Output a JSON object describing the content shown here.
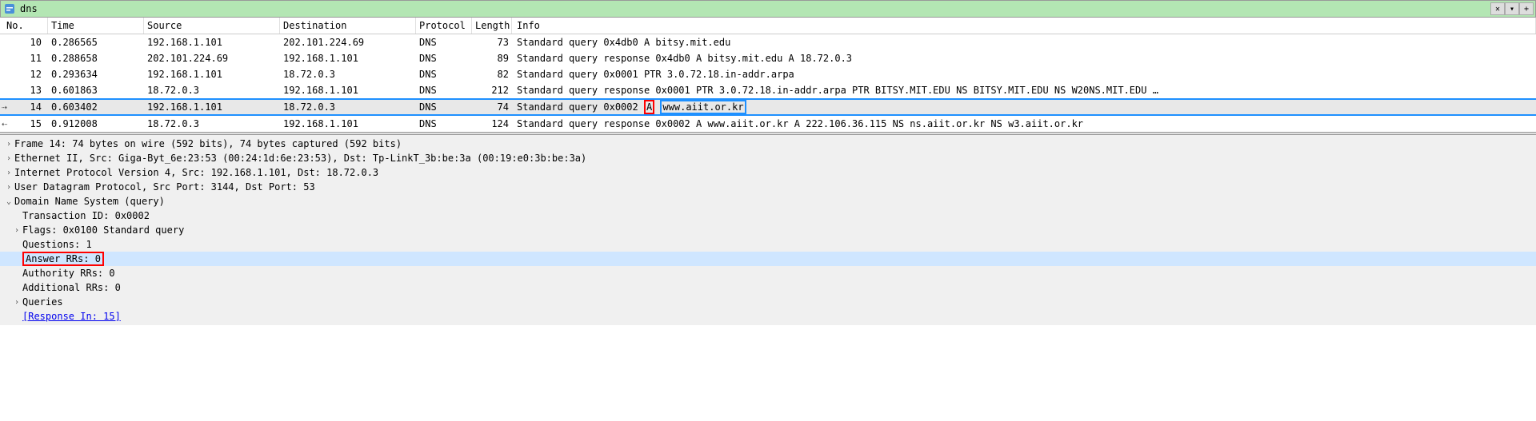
{
  "filter": {
    "value": "dns"
  },
  "columns": {
    "no": "No.",
    "time": "Time",
    "source": "Source",
    "destination": "Destination",
    "protocol": "Protocol",
    "length": "Length",
    "info": "Info"
  },
  "packets": [
    {
      "no": "10",
      "time": "0.286565",
      "src": "192.168.1.101",
      "dst": "202.101.224.69",
      "proto": "DNS",
      "len": "73",
      "info": "Standard query 0x4db0 A bitsy.mit.edu"
    },
    {
      "no": "11",
      "time": "0.288658",
      "src": "202.101.224.69",
      "dst": "192.168.1.101",
      "proto": "DNS",
      "len": "89",
      "info": "Standard query response 0x4db0 A bitsy.mit.edu A 18.72.0.3"
    },
    {
      "no": "12",
      "time": "0.293634",
      "src": "192.168.1.101",
      "dst": "18.72.0.3",
      "proto": "DNS",
      "len": "82",
      "info": "Standard query 0x0001 PTR 3.0.72.18.in-addr.arpa"
    },
    {
      "no": "13",
      "time": "0.601863",
      "src": "18.72.0.3",
      "dst": "192.168.1.101",
      "proto": "DNS",
      "len": "212",
      "info": "Standard query response 0x0001 PTR 3.0.72.18.in-addr.arpa PTR BITSY.MIT.EDU NS BITSY.MIT.EDU NS W20NS.MIT.EDU …"
    },
    {
      "no": "14",
      "time": "0.603402",
      "src": "192.168.1.101",
      "dst": "18.72.0.3",
      "proto": "DNS",
      "len": "74",
      "info_pre": "Standard query 0x0002 ",
      "info_hl1": "A",
      "info_hl2": "www.aiit.or.kr",
      "selected": true
    },
    {
      "no": "15",
      "time": "0.912008",
      "src": "18.72.0.3",
      "dst": "192.168.1.101",
      "proto": "DNS",
      "len": "124",
      "info": "Standard query response 0x0002 A www.aiit.or.kr A 222.106.36.115 NS ns.aiit.or.kr NS w3.aiit.or.kr"
    }
  ],
  "details": {
    "frame": "Frame 14: 74 bytes on wire (592 bits), 74 bytes captured (592 bits)",
    "eth": "Ethernet II, Src: Giga-Byt_6e:23:53 (00:24:1d:6e:23:53), Dst: Tp-LinkT_3b:be:3a (00:19:e0:3b:be:3a)",
    "ip": "Internet Protocol Version 4, Src: 192.168.1.101, Dst: 18.72.0.3",
    "udp": "User Datagram Protocol, Src Port: 3144, Dst Port: 53",
    "dns": "Domain Name System (query)",
    "txid": "Transaction ID: 0x0002",
    "flags": "Flags: 0x0100 Standard query",
    "questions": "Questions: 1",
    "answers": "Answer RRs: 0",
    "authority": "Authority RRs: 0",
    "additional": "Additional RRs: 0",
    "queries": "Queries",
    "response_in": "[Response In: 15]"
  },
  "glyphs": {
    "collapsed": "›",
    "expanded": "⌄",
    "clear": "✕",
    "dropdown": "▾",
    "plus": "+",
    "arrow_out": "→",
    "arrow_in": "←"
  }
}
